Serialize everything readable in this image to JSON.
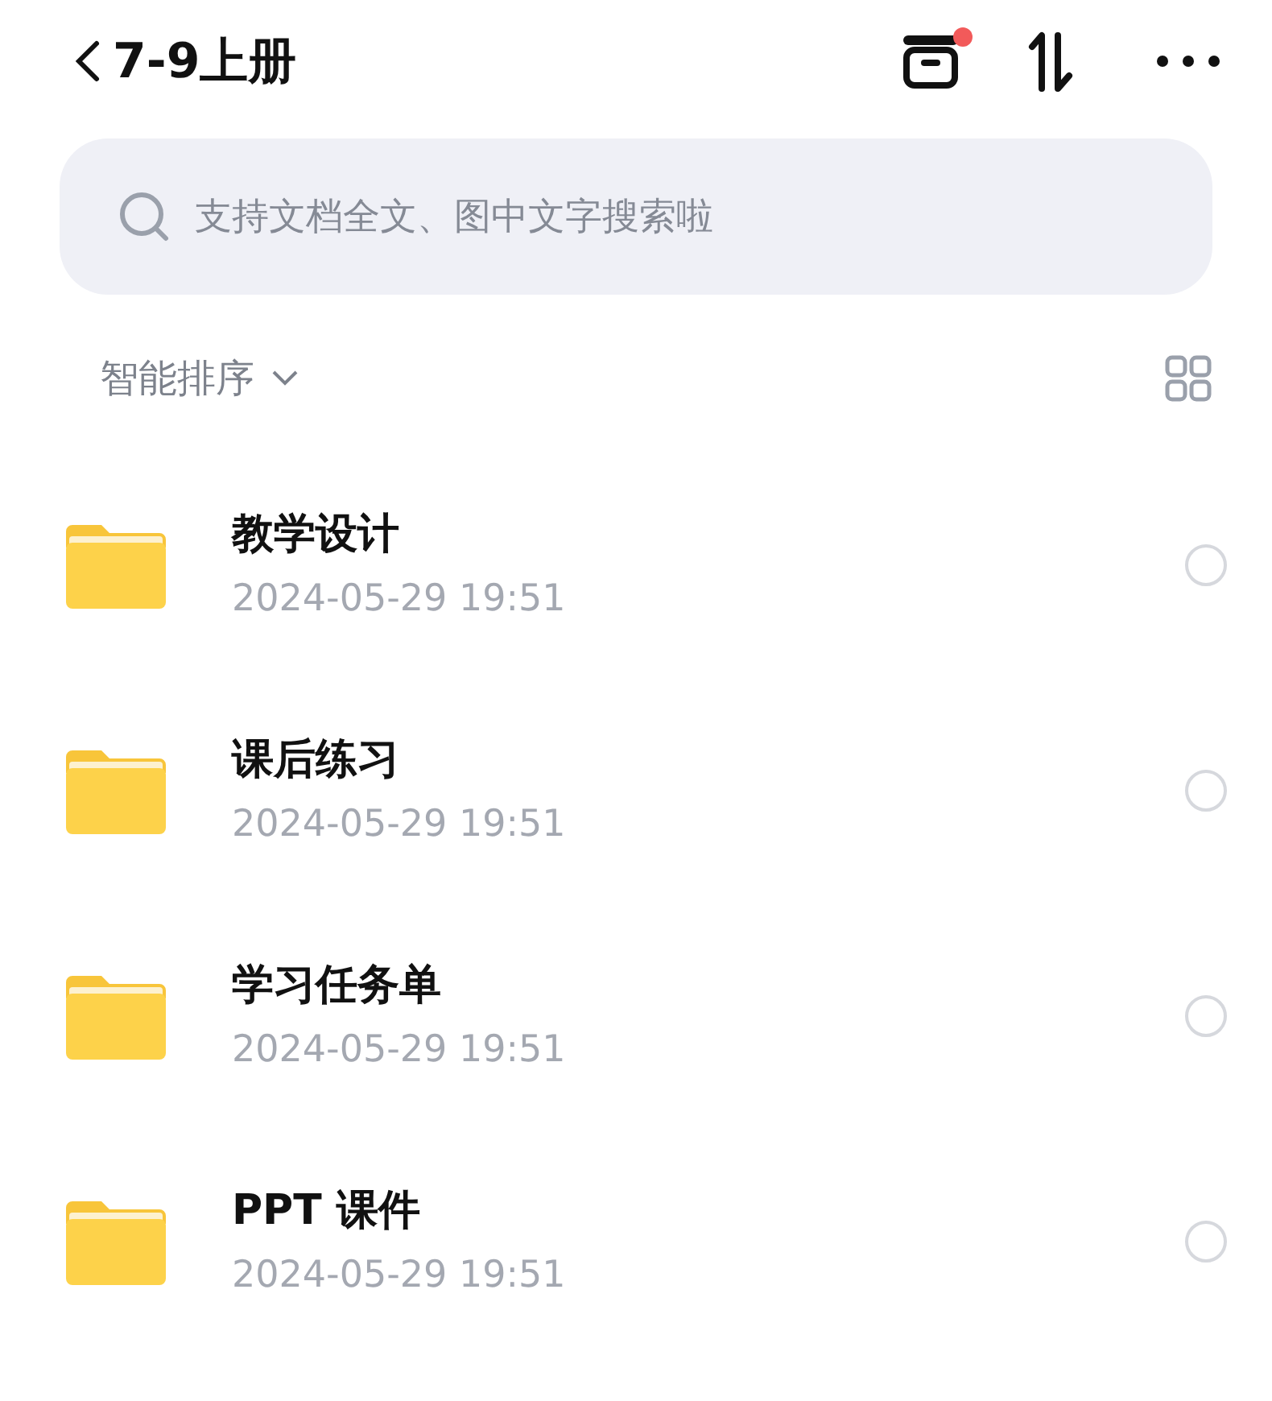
{
  "header": {
    "title": "7-9上册",
    "inbox_badge": true
  },
  "search": {
    "placeholder": "支持文档全文、图中文字搜索啦"
  },
  "sort": {
    "label": "智能排序"
  },
  "folders": [
    {
      "name": "教学设计",
      "date": "2024-05-29 19:51",
      "selected": false
    },
    {
      "name": "课后练习",
      "date": "2024-05-29 19:51",
      "selected": false
    },
    {
      "name": "学习任务单",
      "date": "2024-05-29 19:51",
      "selected": false
    },
    {
      "name": "PPT 课件",
      "date": "2024-05-29 19:51",
      "selected": false
    }
  ]
}
